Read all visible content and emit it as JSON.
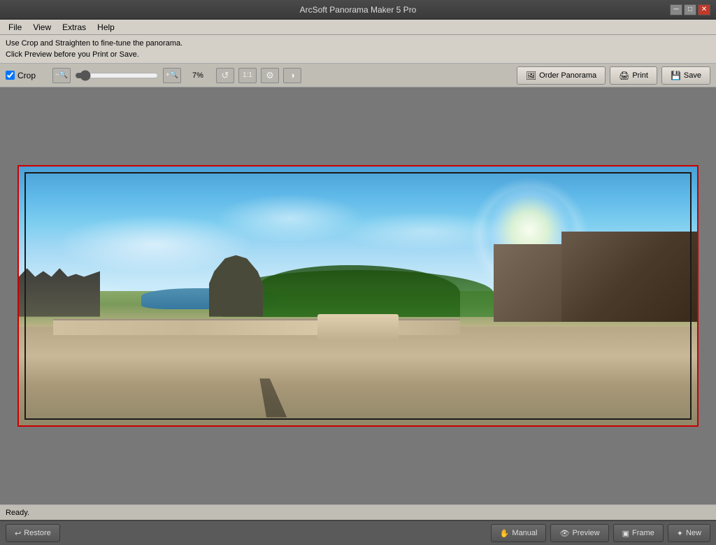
{
  "app": {
    "title": "ArcSoft Panorama Maker 5 Pro",
    "title_full": "ArcSoft Panorama Maker 5 Pro"
  },
  "titlebar": {
    "minimize_label": "─",
    "maximize_label": "□",
    "close_label": "✕"
  },
  "menu": {
    "items": [
      {
        "label": "File"
      },
      {
        "label": "View"
      },
      {
        "label": "Extras"
      },
      {
        "label": "Help"
      }
    ]
  },
  "instructions": {
    "line1": "Use Crop and Straighten to fine-tune the panorama.",
    "line2": "Click Preview before you Print or Save."
  },
  "toolbar": {
    "crop_label": "Crop",
    "zoom_value": "7%",
    "zoom_min": "0",
    "zoom_max": "100",
    "zoom_current": "7",
    "order_label": "Order Panorama",
    "print_label": "Print",
    "save_label": "Save"
  },
  "canvas": {
    "pano_width": "970",
    "pano_height": "370"
  },
  "status": {
    "text": "Ready."
  },
  "bottom": {
    "restore_label": "Restore",
    "manual_label": "Manual",
    "preview_label": "Preview",
    "frame_label": "Frame",
    "new_label": "New"
  },
  "icons": {
    "zoom_out": "🔍",
    "zoom_in": "🔍",
    "rotate": "↺",
    "fit": "⊞",
    "settings": "⚙",
    "color": "🎨",
    "order": "🖼",
    "print": "🖨",
    "save": "💾",
    "restore": "↩",
    "manual": "✋",
    "preview": "👁",
    "frame": "▣",
    "new": "✦"
  }
}
